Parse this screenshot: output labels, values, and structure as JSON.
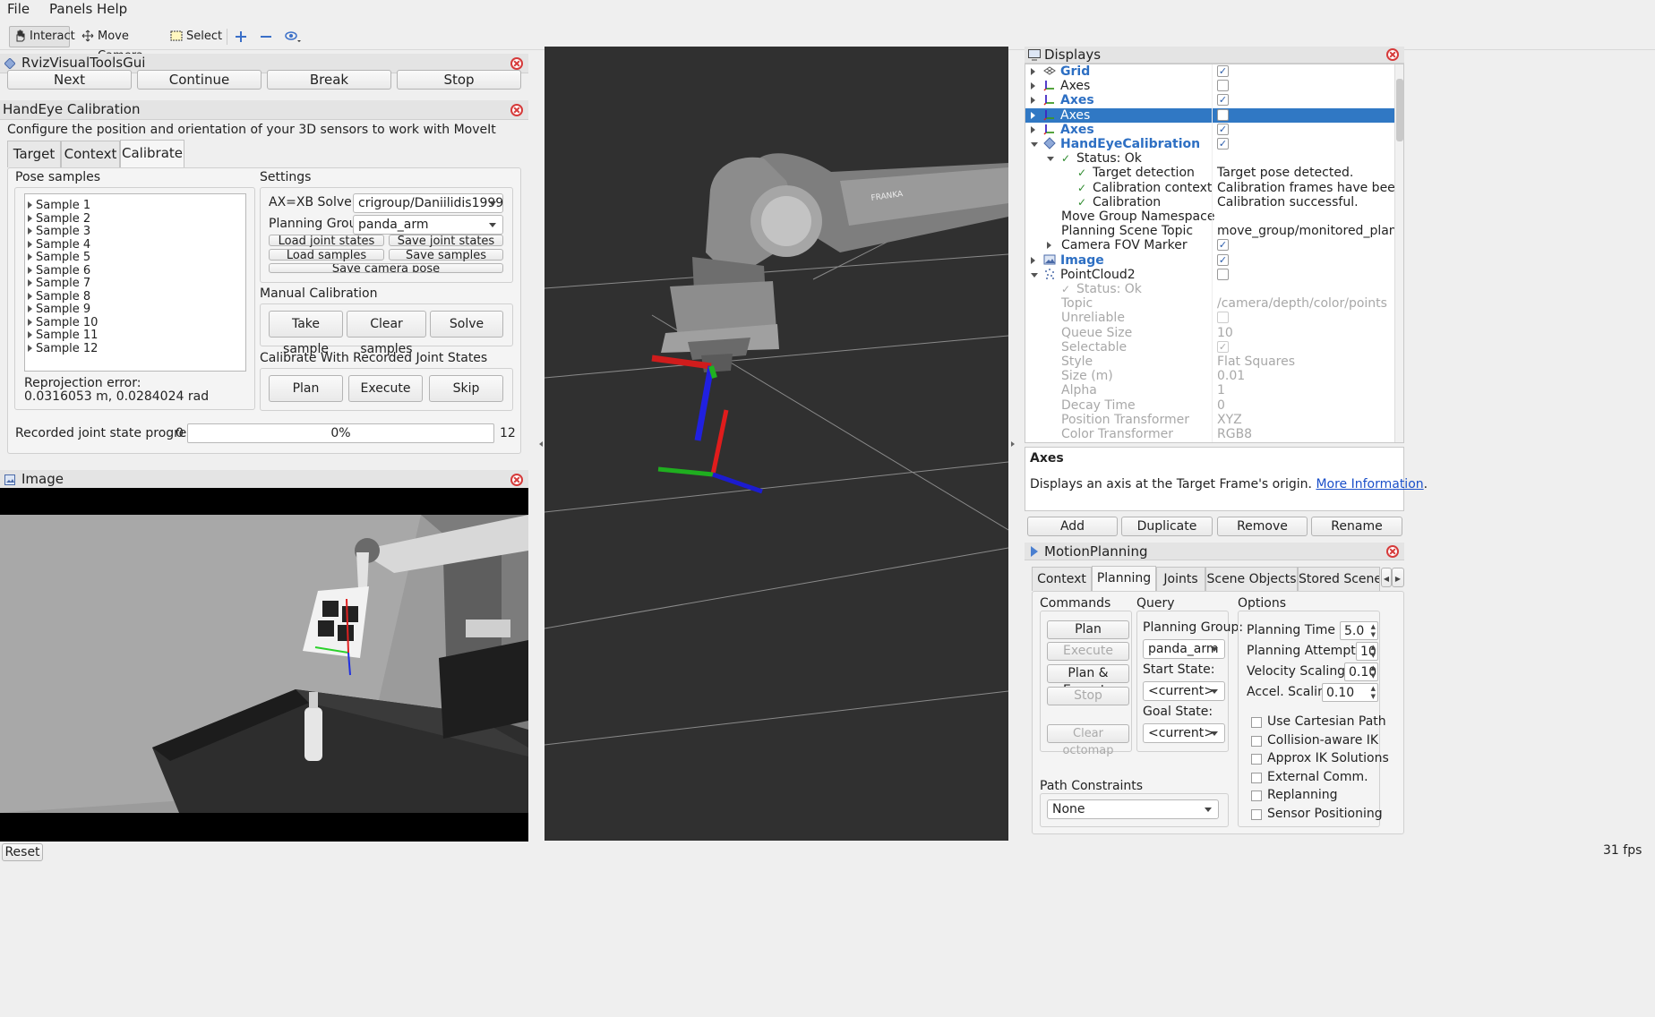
{
  "menu": {
    "file": "File",
    "panels": "Panels",
    "help": "Help"
  },
  "toolbar": {
    "interact": "Interact",
    "move_camera": "Move Camera",
    "select": "Select"
  },
  "rviz_tools": {
    "title": "RvizVisualToolsGui",
    "next": "Next",
    "continue": "Continue",
    "break": "Break",
    "stop": "Stop"
  },
  "handeye": {
    "title": "HandEye Calibration",
    "description": "Configure the position and orientation of your 3D sensors to work with MoveIt",
    "tabs": [
      "Target",
      "Context",
      "Calibrate"
    ],
    "pose_samples_label": "Pose samples",
    "samples": [
      "Sample 1",
      "Sample 2",
      "Sample 3",
      "Sample 4",
      "Sample 5",
      "Sample 6",
      "Sample 7",
      "Sample 8",
      "Sample 9",
      "Sample 10",
      "Sample 11",
      "Sample 12"
    ],
    "reproj_label": "Reprojection error:",
    "reproj_value": "0.0316053 m, 0.0284024 rad",
    "settings_label": "Settings",
    "solver_label": "AX=XB Solver",
    "solver_value": "crigroup/Daniilidis1999",
    "planning_group_label": "Planning Group",
    "planning_group_value": "panda_arm",
    "load_joint": "Load joint states",
    "save_joint": "Save joint states",
    "load_samples": "Load samples",
    "save_samples": "Save samples",
    "save_camera": "Save camera pose",
    "manual_label": "Manual Calibration",
    "take_sample": "Take sample",
    "clear_samples": "Clear samples",
    "solve": "Solve",
    "recorded_label": "Calibrate With Recorded Joint States",
    "plan": "Plan",
    "execute": "Execute",
    "skip": "Skip",
    "progress_label": "Recorded joint state progress:",
    "progress_min": "0",
    "progress_text": "0%",
    "progress_max": "12",
    "progress_fraction": 0
  },
  "image_panel": {
    "title": "Image"
  },
  "displays": {
    "title": "Displays",
    "rows": [
      {
        "label": "Grid",
        "value": "",
        "style": "blue"
      },
      {
        "label": "Axes",
        "value": "",
        "style": "normal"
      },
      {
        "label": "Axes",
        "value": "",
        "style": "blue"
      },
      {
        "label": "Axes",
        "value": "",
        "style": "selected"
      },
      {
        "label": "Axes",
        "value": "",
        "style": "blue"
      },
      {
        "label": "HandEyeCalibration",
        "value": "",
        "style": "blue"
      },
      {
        "label": "Status: Ok",
        "value": "",
        "style": "normal"
      },
      {
        "label": "Target detection",
        "value": "Target pose detected.",
        "style": "normal"
      },
      {
        "label": "Calibration context",
        "value": "Calibration frames have been s...",
        "style": "normal"
      },
      {
        "label": "Calibration",
        "value": "Calibration successful.",
        "style": "normal"
      },
      {
        "label": "Move Group Namespace",
        "value": "",
        "style": "normal"
      },
      {
        "label": "Planning Scene Topic",
        "value": "move_group/monitored_planni...",
        "style": "normal"
      },
      {
        "label": "Camera FOV Marker",
        "value": "",
        "style": "normal"
      },
      {
        "label": "Image",
        "value": "",
        "style": "blue"
      },
      {
        "label": "PointCloud2",
        "value": "",
        "style": "normal"
      },
      {
        "label": "Status: Ok",
        "value": "",
        "style": "dim"
      },
      {
        "label": "Topic",
        "value": "/camera/depth/color/points",
        "style": "dim"
      },
      {
        "label": "Unreliable",
        "value": "",
        "style": "dim"
      },
      {
        "label": "Queue Size",
        "value": "10",
        "style": "dim"
      },
      {
        "label": "Selectable",
        "value": "",
        "style": "dim"
      },
      {
        "label": "Style",
        "value": "Flat Squares",
        "style": "dim"
      },
      {
        "label": "Size (m)",
        "value": "0.01",
        "style": "dim"
      },
      {
        "label": "Alpha",
        "value": "1",
        "style": "dim"
      },
      {
        "label": "Decay Time",
        "value": "0",
        "style": "dim"
      },
      {
        "label": "Position Transformer",
        "value": "XYZ",
        "style": "dim"
      },
      {
        "label": "Color Transformer",
        "value": "RGB8",
        "style": "dim"
      }
    ],
    "desc_title": "Axes",
    "desc_text": "Displays an axis at the Target Frame's origin.",
    "desc_link": "More Information",
    "desc_end": ".",
    "add": "Add",
    "duplicate": "Duplicate",
    "remove": "Remove",
    "rename": "Rename"
  },
  "motion": {
    "title": "MotionPlanning",
    "tabs": [
      "Context",
      "Planning",
      "Joints",
      "Scene Objects",
      "Stored Scene"
    ],
    "commands_label": "Commands",
    "plan": "Plan",
    "execute": "Execute",
    "plan_execute": "Plan & Execute",
    "stop": "Stop",
    "clear_octomap": "Clear octomap",
    "query_label": "Query",
    "planning_group_label": "Planning Group:",
    "planning_group_value": "panda_arm",
    "start_state_label": "Start State:",
    "start_state_value": "<current>",
    "goal_state_label": "Goal State:",
    "goal_state_value": "<current>",
    "options_label": "Options",
    "planning_time_label": "Planning Time (s):",
    "planning_time": "5.0",
    "planning_attempts_label": "Planning Attempts:",
    "planning_attempts": "10",
    "velocity_label": "Velocity Scaling:",
    "velocity": "0.10",
    "accel_label": "Accel. Scaling:",
    "accel": "0.10",
    "options": [
      "Use Cartesian Path",
      "Collision-aware IK",
      "Approx IK Solutions",
      "External Comm.",
      "Replanning",
      "Sensor Positioning"
    ],
    "path_constraints_label": "Path Constraints",
    "path_constraints_value": "None"
  },
  "status": {
    "reset": "Reset",
    "fps": "31 fps"
  },
  "scene": {
    "brand": "FRANKA"
  }
}
